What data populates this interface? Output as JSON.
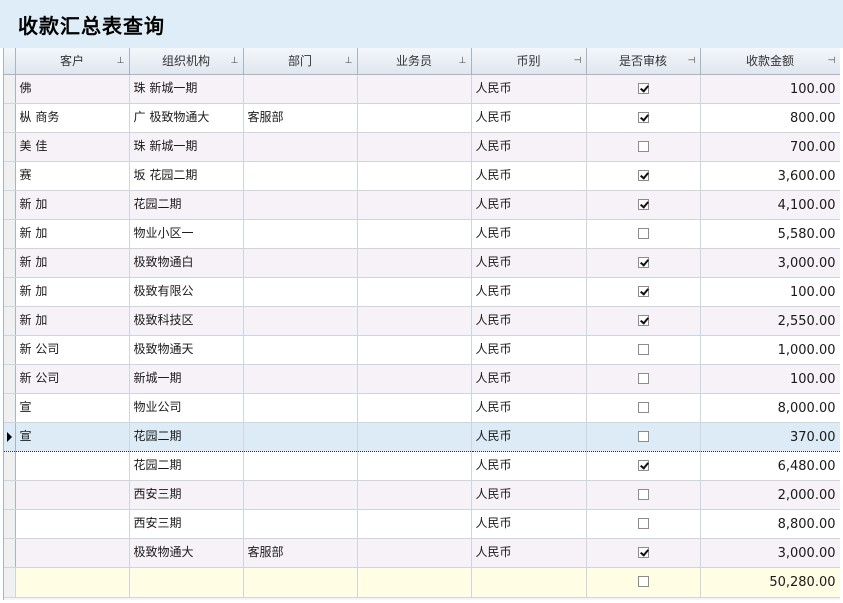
{
  "title": "收款汇总表查询",
  "columns": [
    {
      "key": "customer",
      "label": "客户"
    },
    {
      "key": "org",
      "label": "组织机构"
    },
    {
      "key": "dept",
      "label": "部门"
    },
    {
      "key": "salesman",
      "label": "业务员"
    },
    {
      "key": "currency",
      "label": "币别"
    },
    {
      "key": "audited",
      "label": "是否审核"
    },
    {
      "key": "amount",
      "label": "收款金额"
    }
  ],
  "rows": [
    {
      "customer": "佛",
      "org": "珠 新城一期",
      "dept": "",
      "salesman": "",
      "currency": "人民币",
      "audited": true,
      "amount": "100.00"
    },
    {
      "customer": "枞 商务",
      "org": "广 极致物通大",
      "dept": "客服部",
      "salesman": "",
      "currency": "人民币",
      "audited": true,
      "amount": "800.00"
    },
    {
      "customer": "美 佳",
      "org": "珠 新城一期",
      "dept": "",
      "salesman": "",
      "currency": "人民币",
      "audited": false,
      "amount": "700.00"
    },
    {
      "customer": "赛",
      "org": "坂 花园二期",
      "dept": "",
      "salesman": "",
      "currency": "人民币",
      "audited": true,
      "amount": "3,600.00"
    },
    {
      "customer": "新 加",
      "org": "花园二期",
      "dept": "",
      "salesman": "",
      "currency": "人民币",
      "audited": true,
      "amount": "4,100.00"
    },
    {
      "customer": "新 加",
      "org": "物业小区一",
      "dept": "",
      "salesman": "",
      "currency": "人民币",
      "audited": false,
      "amount": "5,580.00"
    },
    {
      "customer": "新 加",
      "org": "极致物通白",
      "dept": "",
      "salesman": "",
      "currency": "人民币",
      "audited": true,
      "amount": "3,000.00"
    },
    {
      "customer": "新 加",
      "org": "极致有限公",
      "dept": "",
      "salesman": "",
      "currency": "人民币",
      "audited": true,
      "amount": "100.00"
    },
    {
      "customer": "新 加",
      "org": "极致科技区",
      "dept": "",
      "salesman": "",
      "currency": "人民币",
      "audited": true,
      "amount": "2,550.00"
    },
    {
      "customer": "新 公司",
      "org": "极致物通天",
      "dept": "",
      "salesman": "",
      "currency": "人民币",
      "audited": false,
      "amount": "1,000.00"
    },
    {
      "customer": "新 公司",
      "org": "新城一期",
      "dept": "",
      "salesman": "",
      "currency": "人民币",
      "audited": false,
      "amount": "100.00"
    },
    {
      "customer": "宣",
      "org": "物业公司",
      "dept": "",
      "salesman": "",
      "currency": "人民币",
      "audited": false,
      "amount": "8,000.00"
    },
    {
      "customer": "宣",
      "org": "花园二期",
      "dept": "",
      "salesman": "",
      "currency": "人民币",
      "audited": false,
      "amount": "370.00",
      "selected": true
    },
    {
      "customer": "",
      "org": "花园二期",
      "dept": "",
      "salesman": "",
      "currency": "人民币",
      "audited": true,
      "amount": "6,480.00"
    },
    {
      "customer": "",
      "org": "西安三期",
      "dept": "",
      "salesman": "",
      "currency": "人民币",
      "audited": false,
      "amount": "2,000.00"
    },
    {
      "customer": "",
      "org": "西安三期",
      "dept": "",
      "salesman": "",
      "currency": "人民币",
      "audited": false,
      "amount": "8,800.00"
    },
    {
      "customer": "",
      "org": "极致物通大",
      "dept": "客服部",
      "salesman": "",
      "currency": "人民币",
      "audited": true,
      "amount": "3,000.00"
    }
  ],
  "footer": {
    "audited": false,
    "amount": "50,280.00"
  }
}
